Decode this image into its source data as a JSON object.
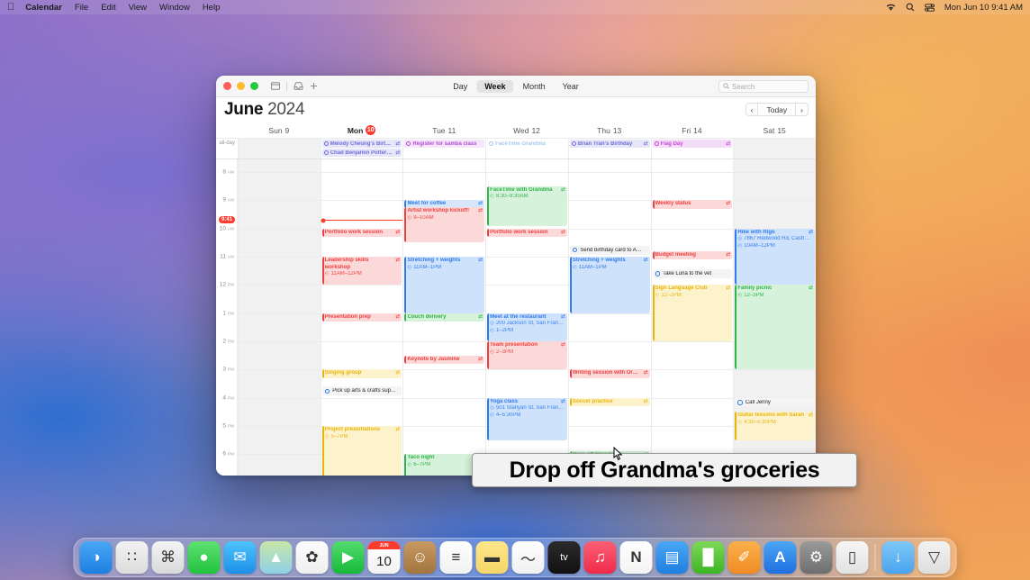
{
  "menubar": {
    "apple_icon": "apple-icon",
    "items": [
      "Calendar",
      "File",
      "Edit",
      "View",
      "Window",
      "Help"
    ],
    "right_icons": [
      "wifi-icon",
      "search-icon",
      "control-center-icon"
    ],
    "clock": "Mon Jun 10  9:41 AM"
  },
  "window": {
    "toolbar": {
      "icons": [
        "calendar-view-icon",
        "inbox-icon",
        "add-event-icon"
      ],
      "views": [
        "Day",
        "Week",
        "Month",
        "Year"
      ],
      "active_view": "Week",
      "search_placeholder": "Search"
    },
    "month": {
      "name": "June",
      "year": "2024"
    },
    "nav": {
      "prev": "‹",
      "today": "Today",
      "next": "›"
    },
    "all_day_label": "all-day",
    "days": [
      {
        "label": "Sun 9",
        "weekday": "Sun",
        "num": "9",
        "today": false,
        "shaded": true
      },
      {
        "label": "Mon 10",
        "weekday": "Mon",
        "num": "10",
        "today": true,
        "shaded": false
      },
      {
        "label": "Tue 11",
        "weekday": "Tue",
        "num": "11",
        "today": false,
        "shaded": false
      },
      {
        "label": "Wed 12",
        "weekday": "Wed",
        "num": "12",
        "today": false,
        "shaded": false
      },
      {
        "label": "Thu 13",
        "weekday": "Thu",
        "num": "13",
        "today": false,
        "shaded": false
      },
      {
        "label": "Fri 14",
        "weekday": "Fri",
        "num": "14",
        "today": false,
        "shaded": false
      },
      {
        "label": "Sat 15",
        "weekday": "Sat",
        "num": "15",
        "today": false,
        "shaded": true
      }
    ],
    "time_labels": [
      {
        "hour": "8",
        "ampm": "AM"
      },
      {
        "hour": "9",
        "ampm": "AM"
      },
      {
        "hour": "10",
        "ampm": "AM"
      },
      {
        "hour": "11",
        "ampm": "AM"
      },
      {
        "hour": "12",
        "ampm": "PM"
      },
      {
        "hour": "1",
        "ampm": "PM"
      },
      {
        "hour": "2",
        "ampm": "PM"
      },
      {
        "hour": "3",
        "ampm": "PM"
      },
      {
        "hour": "4",
        "ampm": "PM"
      },
      {
        "hour": "5",
        "ampm": "PM"
      },
      {
        "hour": "6",
        "ampm": "PM"
      }
    ],
    "now": {
      "time": "9:41",
      "day_index": 1
    },
    "all_day_events": [
      {
        "day": 1,
        "title": "Melody Cheung's Birt…",
        "color": "#6e6ed8",
        "bg": "#e6e6f8",
        "kind": "birthday",
        "repeat": true
      },
      {
        "day": 1,
        "title": "Chad Benjamin Potter…",
        "color": "#6e6ed8",
        "bg": "#e6e6f8",
        "kind": "birthday",
        "repeat": true
      },
      {
        "day": 2,
        "title": "Register for samba class",
        "color": "#b44bd6",
        "bg": "#f6e6fb",
        "kind": "reminder",
        "repeat": false
      },
      {
        "day": 3,
        "title": "FaceTime Grandma",
        "color": "#a8c6f0",
        "bg": "#ffffff",
        "kind": "reminder-done",
        "repeat": false
      },
      {
        "day": 4,
        "title": "Brian Tran's Birthday",
        "color": "#6e6ed8",
        "bg": "#e6e6f8",
        "kind": "birthday",
        "repeat": true
      },
      {
        "day": 5,
        "title": "Flag Day",
        "color": "#c74ad8",
        "bg": "#f3dcf8",
        "kind": "holiday",
        "repeat": true
      }
    ],
    "events": [
      {
        "day": 2,
        "title": "Meet for coffee",
        "time": "",
        "loc": "",
        "start": 9.0,
        "end": 9.25,
        "color": "#2f7bea",
        "bg": "#d6e6fb",
        "repeat": true
      },
      {
        "day": 2,
        "title": "Artist workshop kickoff!",
        "time": "9–10AM",
        "loc": "",
        "start": 9.25,
        "end": 10.5,
        "color": "#f03e3e",
        "bg": "#fbd9d9",
        "repeat": true
      },
      {
        "day": 3,
        "title": "FaceTime with Grandma",
        "time": "8:30–9:30AM",
        "loc": "",
        "start": 8.5,
        "end": 9.9,
        "color": "#2fb34a",
        "bg": "#d6f2da",
        "repeat": true
      },
      {
        "day": 5,
        "title": "Weekly status",
        "time": "",
        "loc": "",
        "start": 9.0,
        "end": 9.3,
        "color": "#f03e3e",
        "bg": "#fbd9d9",
        "repeat": true
      },
      {
        "day": 1,
        "title": "Portfolio work session",
        "time": "",
        "loc": "",
        "start": 10.0,
        "end": 10.3,
        "color": "#f03e3e",
        "bg": "#fbd9d9",
        "repeat": true
      },
      {
        "day": 3,
        "title": "Portfolio work session",
        "time": "",
        "loc": "",
        "start": 10.0,
        "end": 10.3,
        "color": "#f03e3e",
        "bg": "#fbd9d9",
        "repeat": true
      },
      {
        "day": 6,
        "title": "Hike with Rigo",
        "time": "10AM–12PM",
        "loc": "7867 Redwood Rd, Castr…",
        "start": 10.0,
        "end": 12.0,
        "color": "#2f7bea",
        "bg": "#cfe2fb",
        "repeat": true
      },
      {
        "day": 5,
        "title": "Budget meeting",
        "time": "",
        "loc": "",
        "start": 10.8,
        "end": 11.1,
        "color": "#f03e3e",
        "bg": "#fbd9d9",
        "repeat": true
      },
      {
        "day": 1,
        "title": "Leadership skills workshop",
        "time": "11AM–12PM",
        "loc": "",
        "start": 11.0,
        "end": 12.0,
        "color": "#f03e3e",
        "bg": "#fbd9d9",
        "repeat": true,
        "wrap": true
      },
      {
        "day": 2,
        "title": "Stretching + weights",
        "time": "11AM–1PM",
        "loc": "",
        "start": 11.0,
        "end": 13.0,
        "color": "#2f7bea",
        "bg": "#cfe2fb",
        "repeat": true
      },
      {
        "day": 4,
        "title": "Stretching + weights",
        "time": "11AM–1PM",
        "loc": "",
        "start": 11.0,
        "end": 13.0,
        "color": "#2f7bea",
        "bg": "#cfe2fb",
        "repeat": true
      },
      {
        "day": 5,
        "title": "Sign Language Club",
        "time": "12–2PM",
        "loc": "",
        "start": 12.0,
        "end": 14.0,
        "color": "#e8b30b",
        "bg": "#fcf3cc",
        "repeat": true
      },
      {
        "day": 6,
        "title": "Family picnic",
        "time": "12–3PM",
        "loc": "",
        "start": 12.0,
        "end": 15.0,
        "color": "#2fb34a",
        "bg": "#d6f2da",
        "repeat": true
      },
      {
        "day": 1,
        "title": "Presentation prep",
        "time": "",
        "loc": "",
        "start": 13.0,
        "end": 13.3,
        "color": "#f03e3e",
        "bg": "#fbd9d9",
        "repeat": true
      },
      {
        "day": 2,
        "title": "Couch delivery",
        "time": "",
        "loc": "",
        "start": 13.0,
        "end": 13.3,
        "color": "#2fb34a",
        "bg": "#d6f2da",
        "repeat": true
      },
      {
        "day": 3,
        "title": "Meet at the restaurant",
        "time": "1–2PM",
        "loc": "200 Jackson St, San Fran…",
        "start": 13.0,
        "end": 14.0,
        "color": "#2f7bea",
        "bg": "#cfe2fb",
        "repeat": true
      },
      {
        "day": 3,
        "title": "Team presentation",
        "time": "2–3PM",
        "loc": "",
        "start": 14.0,
        "end": 15.0,
        "color": "#f03e3e",
        "bg": "#fbd9d9",
        "repeat": true
      },
      {
        "day": 2,
        "title": "Keynote by Jasmine",
        "time": "",
        "loc": "",
        "start": 14.5,
        "end": 14.8,
        "color": "#f03e3e",
        "bg": "#fbd9d9",
        "repeat": true
      },
      {
        "day": 1,
        "title": "Singing group",
        "time": "",
        "loc": "",
        "start": 15.0,
        "end": 15.3,
        "color": "#e8b30b",
        "bg": "#fcf3cc",
        "repeat": true
      },
      {
        "day": 4,
        "title": "Writing session with Or…",
        "time": "",
        "loc": "",
        "start": 15.0,
        "end": 15.3,
        "color": "#f03e3e",
        "bg": "#fbd9d9",
        "repeat": true
      },
      {
        "day": 3,
        "title": "Yoga class",
        "time": "4–5:30PM",
        "loc": "501 Stanyan St, San Fran…",
        "start": 16.0,
        "end": 17.5,
        "color": "#2f7bea",
        "bg": "#cfe2fb",
        "repeat": true
      },
      {
        "day": 4,
        "title": "Soccer practice",
        "time": "",
        "loc": "",
        "start": 16.0,
        "end": 16.3,
        "color": "#e8b30b",
        "bg": "#fcf3cc",
        "repeat": true
      },
      {
        "day": 6,
        "title": "Guitar lessons with Sarah",
        "time": "4:30–5:30PM",
        "loc": "",
        "start": 16.5,
        "end": 17.5,
        "color": "#e8b30b",
        "bg": "#fcf3cc",
        "repeat": true,
        "wrap": true
      },
      {
        "day": 1,
        "title": "Project presentations",
        "time": "5–7PM",
        "loc": "",
        "start": 17.0,
        "end": 19.0,
        "color": "#e8b30b",
        "bg": "#fcf3cc",
        "repeat": true
      },
      {
        "day": 2,
        "title": "Taco night",
        "time": "6–7PM",
        "loc": "",
        "start": 18.0,
        "end": 19.0,
        "color": "#2fb34a",
        "bg": "#d6f2da",
        "repeat": false
      },
      {
        "day": 4,
        "title": "Drop off Grandma's groceries",
        "time": "",
        "loc": "",
        "start": 17.9,
        "end": 18.6,
        "color": "#2fb34a",
        "bg": "#d6f2da",
        "repeat": true,
        "wrap": true
      }
    ],
    "todos": [
      {
        "day": 4,
        "title": "Send birthday card to A…",
        "at": 10.6
      },
      {
        "day": 5,
        "title": "Take Luna to the vet",
        "at": 11.45
      },
      {
        "day": 1,
        "title": "Pick up arts & crafts sup…",
        "at": 15.6
      },
      {
        "day": 6,
        "title": "Call Jenny",
        "at": 16.0
      }
    ]
  },
  "tooltip": {
    "text": "Drop off Grandma's groceries"
  },
  "dock": {
    "items": [
      {
        "name": "finder",
        "glyph": "◑"
      },
      {
        "name": "launchpad",
        "glyph": "∷"
      },
      {
        "name": "safari",
        "glyph": "⌘"
      },
      {
        "name": "messages",
        "glyph": "●"
      },
      {
        "name": "mail",
        "glyph": "✉"
      },
      {
        "name": "maps",
        "glyph": "▲"
      },
      {
        "name": "photos",
        "glyph": "✿"
      },
      {
        "name": "facetime",
        "glyph": "▶"
      },
      {
        "name": "calendar",
        "glyph": "10",
        "sub": "JUN"
      },
      {
        "name": "contacts",
        "glyph": "☺"
      },
      {
        "name": "reminders",
        "glyph": "≡"
      },
      {
        "name": "notes",
        "glyph": "▬"
      },
      {
        "name": "freeform",
        "glyph": "〜"
      },
      {
        "name": "apple-tv",
        "glyph": "tv"
      },
      {
        "name": "music",
        "glyph": "♫"
      },
      {
        "name": "news",
        "glyph": "N"
      },
      {
        "name": "keynote",
        "glyph": "▤"
      },
      {
        "name": "numbers",
        "glyph": "█"
      },
      {
        "name": "pages",
        "glyph": "✐"
      },
      {
        "name": "app-store",
        "glyph": "A"
      },
      {
        "name": "system-settings",
        "glyph": "⚙"
      },
      {
        "name": "iphone-mirroring",
        "glyph": "▯"
      }
    ],
    "right_items": [
      {
        "name": "downloads-folder",
        "glyph": "↓"
      },
      {
        "name": "trash",
        "glyph": "▽"
      }
    ]
  }
}
